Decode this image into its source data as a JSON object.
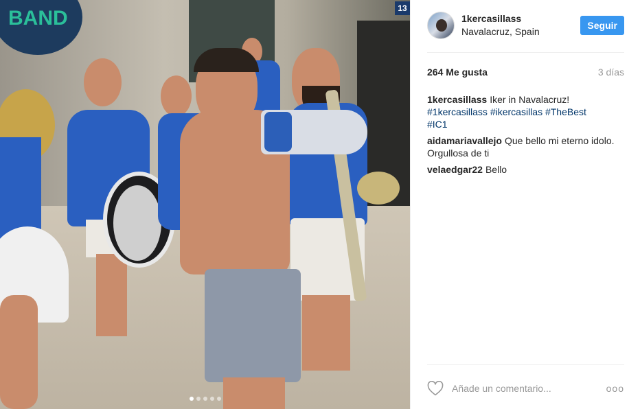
{
  "media": {
    "sign_text": "BAND",
    "house_number": "13",
    "carousel": {
      "count": 5,
      "active_index": 0
    }
  },
  "header": {
    "username": "1kercasillass",
    "location": "Navalacruz, Spain",
    "follow_label": "Seguir"
  },
  "stats": {
    "likes": "264 Me gusta",
    "age": "3 días"
  },
  "caption": {
    "username": "1kercasillass",
    "text": "Iker in Navalacruz!",
    "hashtags": [
      "#1kercasillass",
      "#ikercasillas",
      "#TheBest",
      "#IC1"
    ]
  },
  "comments": [
    {
      "username": "aidamariavallejo",
      "text": "Que bello mi eterno idolo. Orgullosa de ti"
    },
    {
      "username": "velaedgar22",
      "text": "Bello"
    }
  ],
  "add_comment": {
    "placeholder": "Añade un comentario...",
    "more_label": "ooo"
  },
  "icons": {
    "heart": "heart-outline-icon",
    "more": "more-options-icon"
  },
  "colors": {
    "follow_button": "#3897f0",
    "hashtag": "#003569",
    "muted": "#999999"
  }
}
